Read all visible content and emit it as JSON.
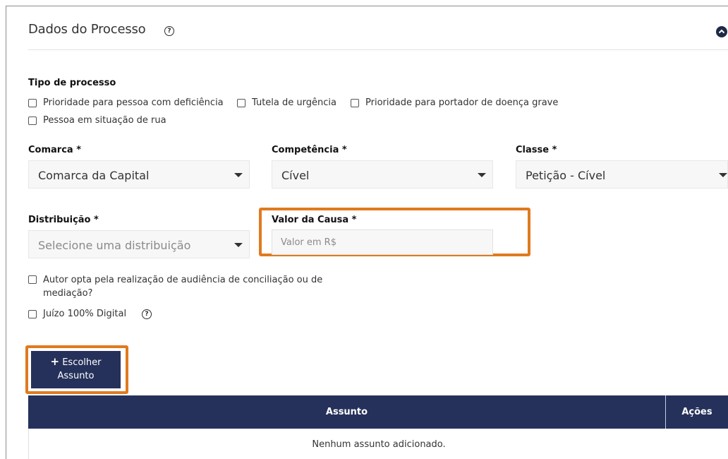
{
  "section": {
    "title": "Dados do Processo",
    "help_icon": "question-circle-icon",
    "collapse_icon": "chevron-up-circle-icon"
  },
  "tipo_processo": {
    "label": "Tipo de processo",
    "options": [
      "Prioridade para pessoa com deficiência",
      "Tutela de urgência",
      "Prioridade para portador de doença grave",
      "Pessoa em situação de rua"
    ]
  },
  "fields": {
    "comarca": {
      "label": "Comarca *",
      "value": "Comarca da Capital"
    },
    "competencia": {
      "label": "Competência *",
      "value": "Cível"
    },
    "classe": {
      "label": "Classe *",
      "value": "Petição - Cível"
    },
    "distribuicao": {
      "label": "Distribuição *",
      "placeholder": "Selecione uma distribuição"
    },
    "valor_causa": {
      "label": "Valor da Causa *",
      "placeholder": "Valor em R$",
      "value": ""
    }
  },
  "options_extra": {
    "audiencia": "Autor opta pela realização de audiência de conciliação ou de mediação?",
    "audiencia_line1": "Autor opta pela realização de audiência de conciliação ou de",
    "audiencia_line2": "mediação?",
    "juizo_digital": "Juízo 100% Digital"
  },
  "button": {
    "icon": "plus-icon",
    "label_line1": "Escolher",
    "label_line2": "Assunto"
  },
  "table": {
    "columns": [
      "Assunto",
      "Ações"
    ],
    "empty_message": "Nenhum assunto adicionado."
  },
  "colors": {
    "accent_navy": "#25315a",
    "highlight_orange": "#e07a1f"
  }
}
